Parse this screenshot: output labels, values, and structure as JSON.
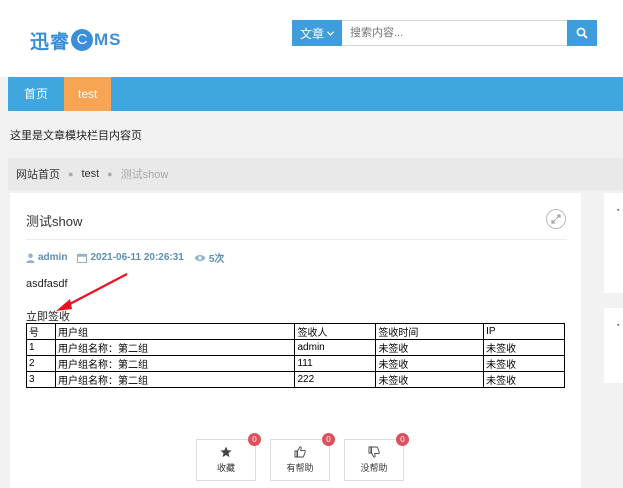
{
  "header": {
    "logo_prefix": "迅睿",
    "logo_c": "C",
    "logo_suffix": "MS",
    "brand_color": "#3a8fd8"
  },
  "search": {
    "category": "文章",
    "placeholder": "搜索内容...",
    "button_icon": "search-icon"
  },
  "nav": {
    "items": [
      {
        "label": "首页",
        "active": false
      },
      {
        "label": "test",
        "active": true
      }
    ],
    "bg_color": "#3fa6de",
    "active_color": "#f6a554"
  },
  "intro": "这里是文章模块栏目内容页",
  "breadcrumb": {
    "home": "网站首页",
    "category": "test",
    "current": "测试show"
  },
  "article": {
    "title": "测试show",
    "author": "admin",
    "datetime": "2021-06-11 20:26:31",
    "views": "5次",
    "body": "asdfasdf",
    "signin_label": "立即签收"
  },
  "table": {
    "headers": [
      "号",
      "用户组",
      "签收人",
      "签收时间",
      "IP"
    ],
    "rows": [
      [
        "1",
        "用户组名称：第二组",
        "admin",
        "未签收",
        "未签收"
      ],
      [
        "2",
        "用户组名称：第二组",
        "111",
        "未签收",
        "未签收"
      ],
      [
        "3",
        "用户组名称：第二组",
        "222",
        "未签收",
        "未签收"
      ]
    ]
  },
  "actions": [
    {
      "label": "收藏",
      "count": "0",
      "icon": "star-icon"
    },
    {
      "label": "有帮助",
      "count": "0",
      "icon": "thumbs-up-icon"
    },
    {
      "label": "没帮助",
      "count": "0",
      "icon": "thumbs-down-icon"
    }
  ]
}
